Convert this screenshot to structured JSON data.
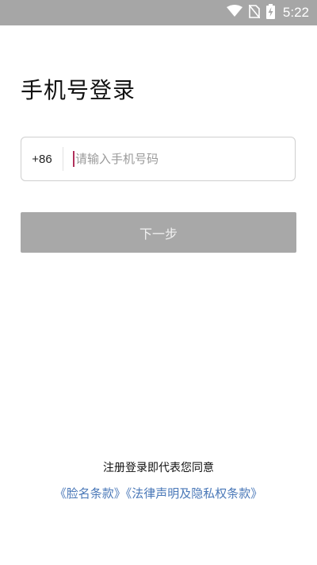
{
  "status_bar": {
    "time": "5:22",
    "icons": [
      "wifi-icon",
      "no-sim-icon",
      "battery-charging-icon"
    ]
  },
  "page": {
    "title": "手机号登录"
  },
  "phone_field": {
    "country_code": "+86",
    "placeholder": "请输入手机号码",
    "value": ""
  },
  "next_button": {
    "label": "下一步"
  },
  "agreement": {
    "notice": "注册登录即代表您同意",
    "link_privacy_faces": "《脸名条款》",
    "link_legal": "《法律声明及隐私权条款》"
  },
  "colors": {
    "status_bar_bg": "#a6a6a6",
    "button_disabled_bg": "#a8a8a8",
    "link": "#4a78b8",
    "cursor": "#b0305b"
  }
}
